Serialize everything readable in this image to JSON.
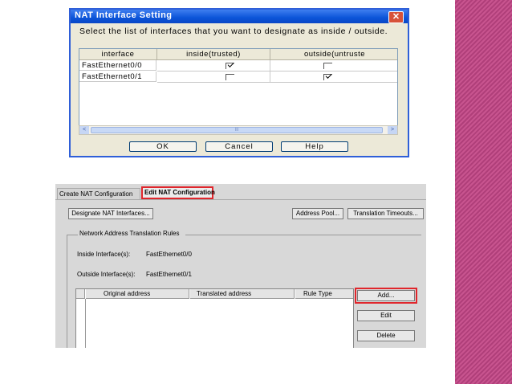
{
  "dialog": {
    "title": "NAT Interface Setting",
    "close_glyph": "✕",
    "instruction": "Select the list of interfaces that you want to designate as inside / outside.",
    "columns": [
      "interface",
      "inside(trusted)",
      "outside(untruste"
    ],
    "rows": [
      {
        "interface": "FastEthernet0/0",
        "inside": true,
        "outside": false
      },
      {
        "interface": "FastEthernet0/1",
        "inside": false,
        "outside": true
      }
    ],
    "scroll_left": "<",
    "scroll_right": ">",
    "scroll_grip": "III",
    "buttons": {
      "ok": "OK",
      "cancel": "Cancel",
      "help": "Help"
    }
  },
  "config": {
    "tabs": {
      "create": "Create NAT Configuration",
      "edit": "Edit NAT Configuration"
    },
    "designate_button": "Designate NAT Interfaces...",
    "address_pool_button": "Address Pool...",
    "translation_timeouts_button": "Translation Timeouts...",
    "group_title": "Network Address Translation Rules",
    "inside_label": "Inside Interface(s):",
    "inside_value": "FastEthernet0/0",
    "outside_label": "Outside Interface(s):",
    "outside_value": "FastEthernet0/1",
    "table_columns": [
      "Original address",
      "Translated address",
      "Rule Type"
    ],
    "buttons": {
      "add": "Add...",
      "edit": "Edit",
      "delete": "Delete"
    }
  },
  "colors": {
    "xp_title_blue": "#0b54d8",
    "highlight_red": "#e0262c",
    "side_band_magenta": "#b03f7a"
  }
}
